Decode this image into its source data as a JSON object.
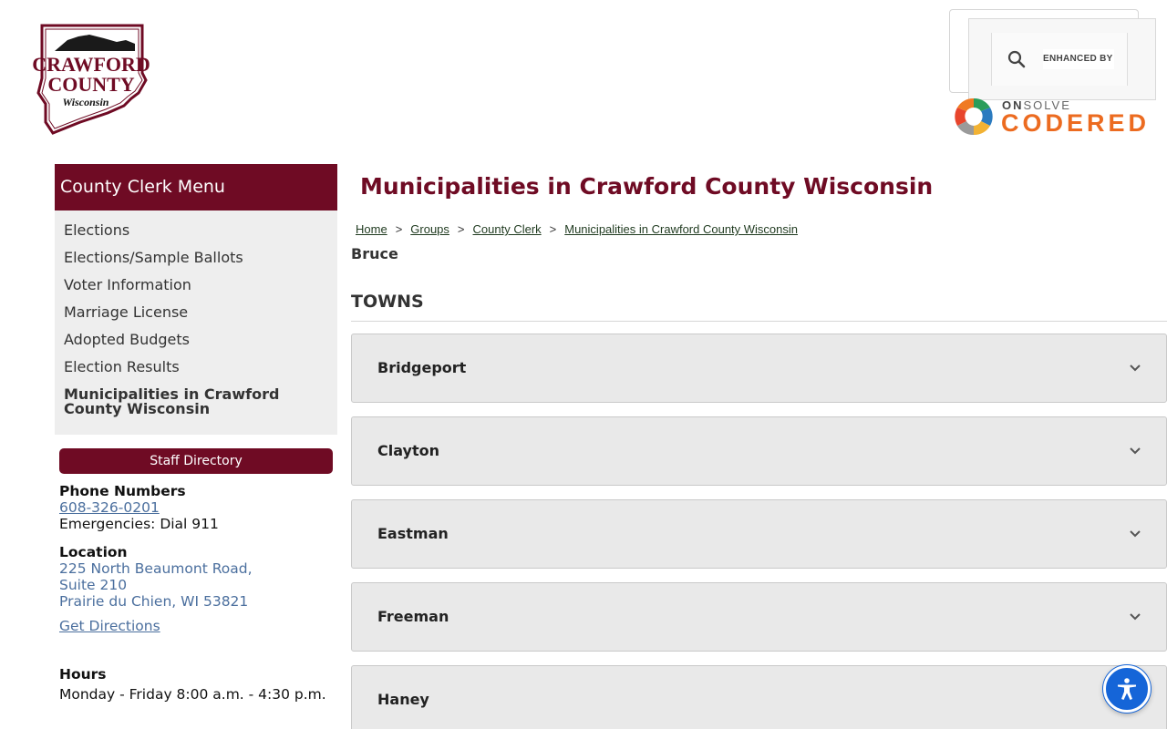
{
  "header": {
    "logo": {
      "line1": "CRAWFORD",
      "line2": "COUNTY",
      "line3": "Wisconsin"
    },
    "search": {
      "enhanced_label": "ENHANCED BY"
    },
    "codered": {
      "on": "ON",
      "solve": "SOLVE",
      "brand": "CODERED"
    }
  },
  "sidebar": {
    "menu_title": "County Clerk Menu",
    "items": [
      {
        "label": "Elections"
      },
      {
        "label": "Elections/Sample Ballots"
      },
      {
        "label": "Voter Information"
      },
      {
        "label": "Marriage License"
      },
      {
        "label": "Adopted Budgets"
      },
      {
        "label": "Election Results"
      },
      {
        "label": "Municipalities in Crawford County Wisconsin"
      }
    ],
    "staff_button": "Staff Directory",
    "phone": {
      "heading": "Phone Numbers",
      "number": "608-326-0201",
      "emergency": "Emergencies: Dial 911"
    },
    "location": {
      "heading": "Location",
      "line1": "225 North Beaumont Road,",
      "line2": "Suite 210",
      "line3": "Prairie du Chien, WI 53821",
      "directions": "Get Directions"
    },
    "hours": {
      "heading": "Hours",
      "text": "Monday - Friday 8:00 a.m. - 4:30 p.m."
    }
  },
  "main": {
    "title": "Municipalities in Crawford County Wisconsin",
    "breadcrumb": [
      "Home",
      "Groups",
      "County Clerk",
      "Municipalities in Crawford County Wisconsin"
    ],
    "breadcrumb_sep": ">",
    "subheading": "Bruce",
    "section_title": "TOWNS",
    "towns": [
      "Bridgeport",
      "Clayton",
      "Eastman",
      "Freeman",
      "Haney"
    ]
  },
  "colors": {
    "brand": "#6f0b24",
    "link": "#4b6f9e",
    "accent": "#ec6b20",
    "a11y": "#1565d8"
  }
}
